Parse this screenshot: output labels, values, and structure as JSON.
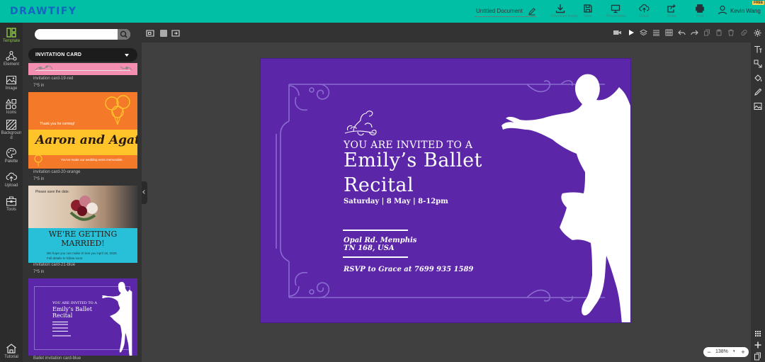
{
  "app": {
    "logo": "DRAWTIFY"
  },
  "header": {
    "doc_title": "Untitled Document",
    "tools": [
      {
        "name": "download-icon",
        "label": "Download Image"
      },
      {
        "name": "save-icon",
        "label": "Save"
      },
      {
        "name": "present-icon",
        "label": "Presentation"
      },
      {
        "name": "cloud-icon",
        "label": "Cloud"
      },
      {
        "name": "share-icon",
        "label": "Share"
      },
      {
        "name": "print-icon",
        "label": "Print"
      }
    ],
    "user_name": "Kevin Wang",
    "free_badge": "FREE"
  },
  "leftnav": [
    {
      "name": "template-icon",
      "label": "Template",
      "active": true
    },
    {
      "name": "element-icon",
      "label": "Element"
    },
    {
      "name": "image-icon",
      "label": "Image"
    },
    {
      "name": "icons-icon",
      "label": "Icons"
    },
    {
      "name": "background-icon",
      "label": "Backgroun d"
    },
    {
      "name": "palette-icon",
      "label": "Palette"
    },
    {
      "name": "upload-icon",
      "label": "Upload"
    },
    {
      "name": "tools-icon",
      "label": "Tools"
    },
    {
      "name": "tutorial-icon",
      "label": "Tutorial"
    }
  ],
  "panel": {
    "search_placeholder": "",
    "category": "INVITATION CARD",
    "templates": [
      {
        "name": "invitation card-19-red",
        "size": "7*5 in"
      },
      {
        "name": "invitation card-20-orange",
        "size": "7*5 in",
        "text_top": "Thank you for coming!",
        "names": "Aaron and Agatha",
        "text_bottom": "You've made our wedding extra memorable."
      },
      {
        "name": "invitation card-21-blue",
        "size": "7*5 in",
        "text_top": "Please save the date.",
        "headline1": "WE'RE GETTING",
        "headline2": "MARRIED!",
        "body1": "We hope you can make it! See you April 18, 2020.",
        "body2": "Full details to follow soon."
      },
      {
        "name": "Ballet invitation card-blue",
        "size": ""
      }
    ]
  },
  "card": {
    "invited": "You are invited to a",
    "title1": "Emily’s Ballet",
    "title2": "Recital",
    "date": "Saturday | 8 May | 8-12pm",
    "address1": "Opal Rd. Memphis",
    "address2": "TN 168, USA",
    "rsvp": "RSVP to Grace at 7699 935 1589"
  },
  "zoom": {
    "level": "138%",
    "minus": "−",
    "plus": "+"
  },
  "colors": {
    "header": "#00bfa5",
    "card": "#5b26a8",
    "active": "#8bc34a",
    "logo": "#1565c0"
  }
}
